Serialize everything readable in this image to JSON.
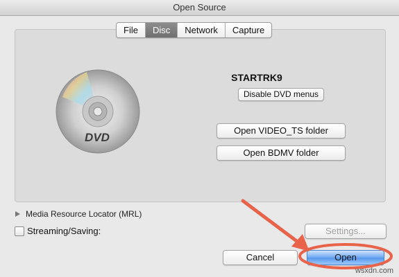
{
  "window": {
    "title": "Open Source"
  },
  "tabs": [
    {
      "label": "File"
    },
    {
      "label": "Disc",
      "active": true
    },
    {
      "label": "Network"
    },
    {
      "label": "Capture"
    }
  ],
  "disc_panel": {
    "disc_name": "STARTRK9",
    "disable_menus_label": "Disable DVD menus",
    "open_video_ts_label": "Open VIDEO_TS folder",
    "open_bdmv_label": "Open BDMV folder",
    "disc_icon_text": "DVD"
  },
  "mrl": {
    "label": "Media Resource Locator (MRL)"
  },
  "streaming": {
    "label": "Streaming/Saving:",
    "checked": false,
    "settings_label": "Settings..."
  },
  "footer": {
    "cancel_label": "Cancel",
    "open_label": "Open"
  },
  "annotation": {
    "color": "#e8634a"
  },
  "watermark": "wsxdn.com",
  "icons": [
    "dvd-disc-icon",
    "disclosure-triangle-icon",
    "checkbox-icon",
    "arrow-annotation-icon"
  ]
}
